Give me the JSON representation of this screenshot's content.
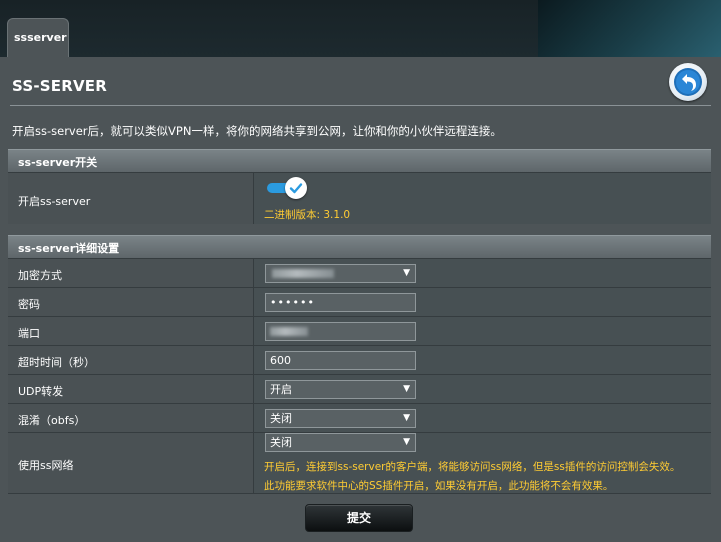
{
  "tab": {
    "label": "ssserver"
  },
  "header": {
    "title": "SS-SERVER"
  },
  "description": "开启ss-server后，就可以类似VPN一样，将你的网络共享到公网，让你和你的小伙伴远程连接。",
  "switch_section": {
    "title": "ss-server开关",
    "enable_label": "开启ss-server",
    "enabled": true,
    "version_text": "二进制版本: 3.1.0"
  },
  "detail_section": {
    "title": "ss-server详细设置",
    "encryption": {
      "label": "加密方式"
    },
    "password": {
      "label": "密码",
      "value": "••••••"
    },
    "port": {
      "label": "端口"
    },
    "timeout": {
      "label": "超时时间（秒）",
      "value": "600"
    },
    "udp": {
      "label": "UDP转发",
      "value": "开启"
    },
    "obfs": {
      "label": "混淆（obfs）",
      "value": "关闭"
    },
    "use_ss": {
      "label": "使用ss网络",
      "value": "关闭",
      "note_line1": "开启后，连接到ss-server的客户端，将能够访问ss网络，但是ss插件的访问控制会失效。",
      "note_line2": "此功能要求软件中心的SS插件开启，如果没有开启，此功能将不会有效果。"
    }
  },
  "submit": {
    "label": "提交"
  },
  "colors": {
    "accent": "#2b9be0",
    "note": "#ffcc33",
    "panel": "#4d5457"
  },
  "icons": {
    "back": "back-arrow-icon",
    "toggle_check": "check-icon",
    "dropdown": "chevron-down-icon"
  }
}
